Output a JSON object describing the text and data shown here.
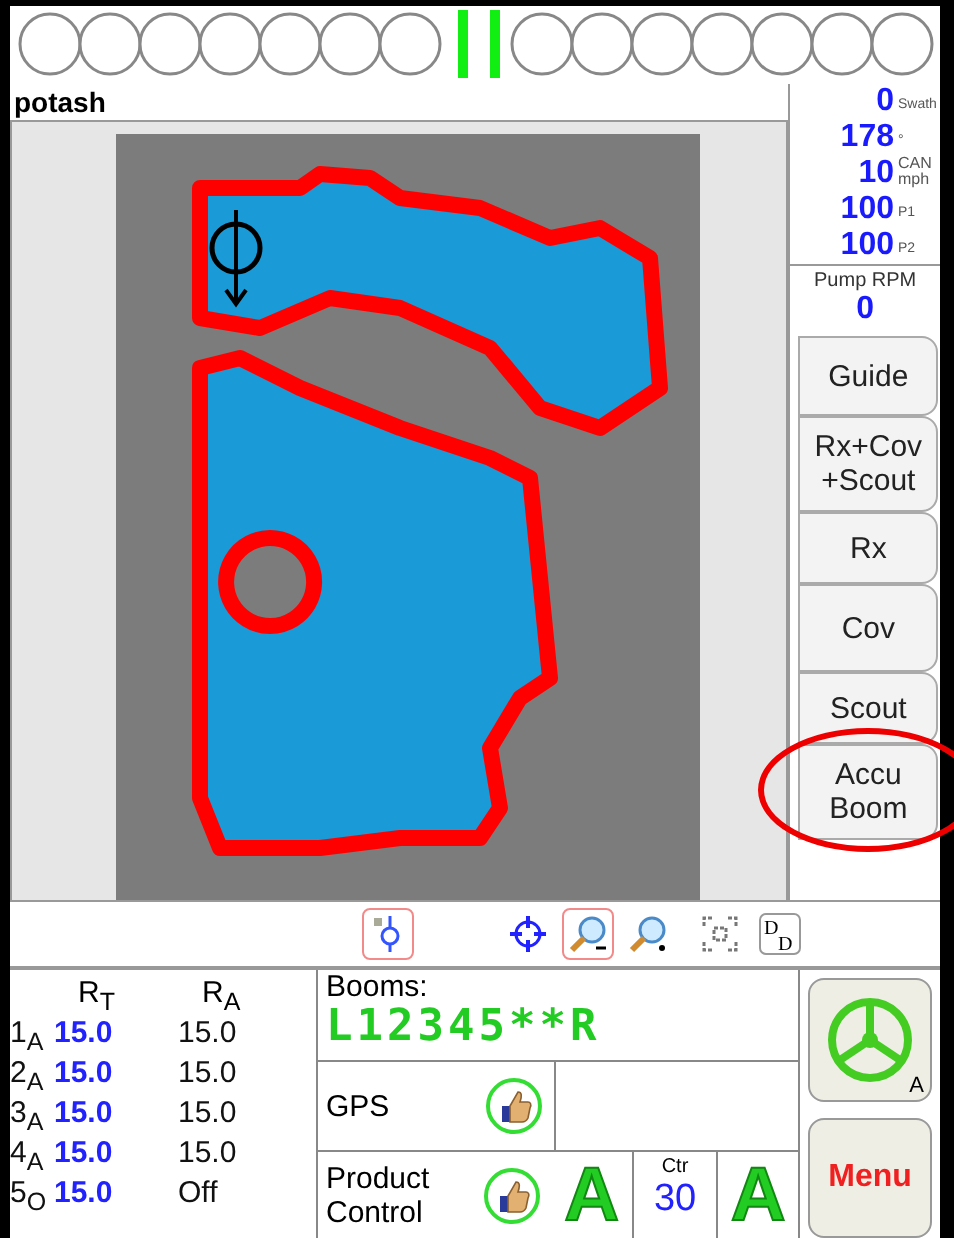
{
  "product": {
    "name": "potash"
  },
  "readouts": [
    {
      "value": "0",
      "unit": "Swath"
    },
    {
      "value": "178",
      "unit": "°"
    },
    {
      "value": "10",
      "unit_top": "CAN",
      "unit": "mph"
    },
    {
      "value": "100",
      "unit": "P1"
    },
    {
      "value": "100",
      "unit": "P2"
    }
  ],
  "pump": {
    "label": "Pump RPM",
    "value": "0"
  },
  "side_buttons": [
    {
      "label": "Guide"
    },
    {
      "label": "Rx+Cov +Scout"
    },
    {
      "label": "Rx"
    },
    {
      "label": "Cov"
    },
    {
      "label": "Scout"
    },
    {
      "label": "Accu Boom",
      "highlighted": true
    }
  ],
  "toolbar": [
    {
      "kind": "layers",
      "selected": true
    },
    {
      "kind": "center",
      "selected": false
    },
    {
      "kind": "zoom-in",
      "selected": true
    },
    {
      "kind": "zoom-out",
      "selected": false
    },
    {
      "kind": "extent",
      "selected": false
    },
    {
      "kind": "dd",
      "letters": [
        "D",
        "D"
      ],
      "selected": false
    }
  ],
  "rates": {
    "headers": [
      "R$_{T}$",
      "R$_{A}$"
    ],
    "rows": [
      {
        "label": "1$_{A}$",
        "target": "15.0",
        "actual": "15.0"
      },
      {
        "label": "2$_{A}$",
        "target": "15.0",
        "actual": "15.0"
      },
      {
        "label": "3$_{A}$",
        "target": "15.0",
        "actual": "15.0"
      },
      {
        "label": "4$_{A}$",
        "target": "15.0",
        "actual": "15.0"
      },
      {
        "label": "5$_{O}$",
        "target": "15.0",
        "actual": "Off"
      }
    ]
  },
  "booms": {
    "label": "Booms:",
    "value": "L12345**R"
  },
  "gps": {
    "label": "GPS",
    "ok": true
  },
  "product_control": {
    "label": "Product Control",
    "ok": true,
    "mode_left": "A",
    "center_label": "Ctr",
    "center_value": "30",
    "mode_right": "A"
  },
  "steering": {
    "mode": "A"
  },
  "menu_button": {
    "label": "Menu"
  }
}
